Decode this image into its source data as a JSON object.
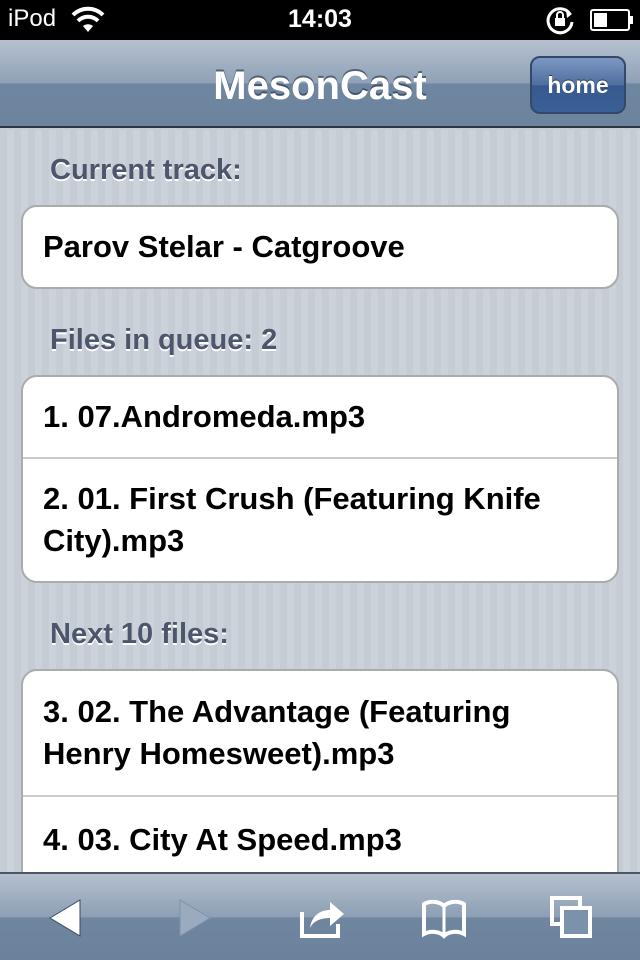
{
  "status_bar": {
    "carrier": "iPod",
    "time": "14:03"
  },
  "nav": {
    "title": "MesonCast",
    "home_label": "home"
  },
  "sections": {
    "current_header": "Current track:",
    "current_track": "Parov Stelar - Catgroove",
    "queue_header": "Files in queue: 2",
    "queue_items": [
      "1. 07.Andromeda.mp3",
      "2. 01. First Crush (Featuring Knife City).mp3"
    ],
    "next_header": "Next 10 files:",
    "next_items": [
      "3. 02. The Advantage (Featuring Henry Homesweet).mp3",
      "4. 03. City At Speed.mp3"
    ]
  },
  "toolbar": {
    "icons": [
      "back-arrow-icon",
      "forward-arrow-icon",
      "share-icon",
      "bookmarks-icon",
      "tabs-icon"
    ]
  },
  "colors": {
    "section_header": "#4c566c",
    "nav_button": "#3a5f96"
  }
}
